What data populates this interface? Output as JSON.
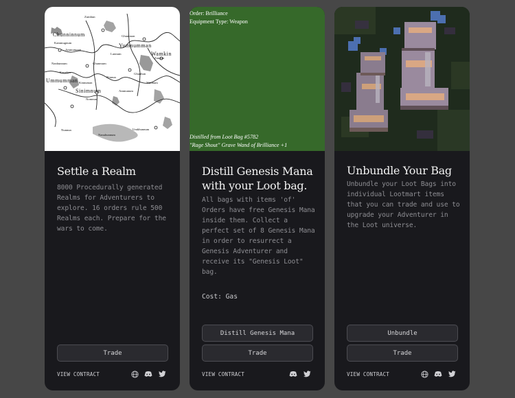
{
  "cards": [
    {
      "title": "Settle a Realm",
      "description": "8000 Procedurally generated Realms for Adventurers to explore. 16 orders rule 500 Realms each. Prepare for the wars to come.",
      "buttons": [
        "Trade"
      ],
      "view_contract": "VIEW CONTRACT",
      "icons": [
        "globe-icon",
        "discord-icon",
        "twitter-icon"
      ],
      "map_labels_big": [
        "Chunninnum",
        "Yumnumman",
        "Wamkin",
        "Ummumman",
        "Sinimnum"
      ],
      "map_labels_small": [
        "Zumhun",
        "Ghumman",
        "Kammugnum",
        "Ammumnun",
        "Zangun",
        "Lunnum",
        "Nanhunnum",
        "Ghunmum",
        "Kannkin",
        "Kinnuman",
        "Ghunhun",
        "Ninnun",
        "Nomnun",
        "Ammunum",
        "Yumnum",
        "Nanuhunnum",
        "Umkhunnum",
        "Nunnun"
      ]
    },
    {
      "title": "Distill Genesis Mana with your Loot bag.",
      "description": "All bags with items 'of' Orders have free Genesis Mana inside them. Collect a perfect set of 8 Genesis Mana in order to resurrect a Genesis Adventurer and receive its \"Genesis Loot\" bag.",
      "cost": "Cost: Gas",
      "buttons": [
        "Distill Genesis Mana",
        "Trade"
      ],
      "view_contract": "VIEW CONTRACT",
      "icons": [
        "discord-icon",
        "twitter-icon"
      ],
      "art_top_lines": [
        "Order: Brilliance",
        "Equipment Type: Weapon"
      ],
      "art_bottom_lines": [
        "Distilled from Loot Bag #5782",
        "\"Rage Shout\" Grave Wand of Brilliance +1"
      ]
    },
    {
      "title": "Unbundle Your Bag",
      "description": "Unbundle your Loot Bags into individual Lootmart items that you can trade and use to upgrade your Adventurer in the Loot universe.",
      "buttons": [
        "Unbundle",
        "Trade"
      ],
      "view_contract": "VIEW CONTRACT",
      "icons": [
        "globe-icon",
        "discord-icon",
        "twitter-icon"
      ]
    }
  ],
  "colors": {
    "page_bg": "#474747",
    "card_bg": "#19191d",
    "button_bg": "#2a2a2f",
    "green_art": "#36692a"
  }
}
